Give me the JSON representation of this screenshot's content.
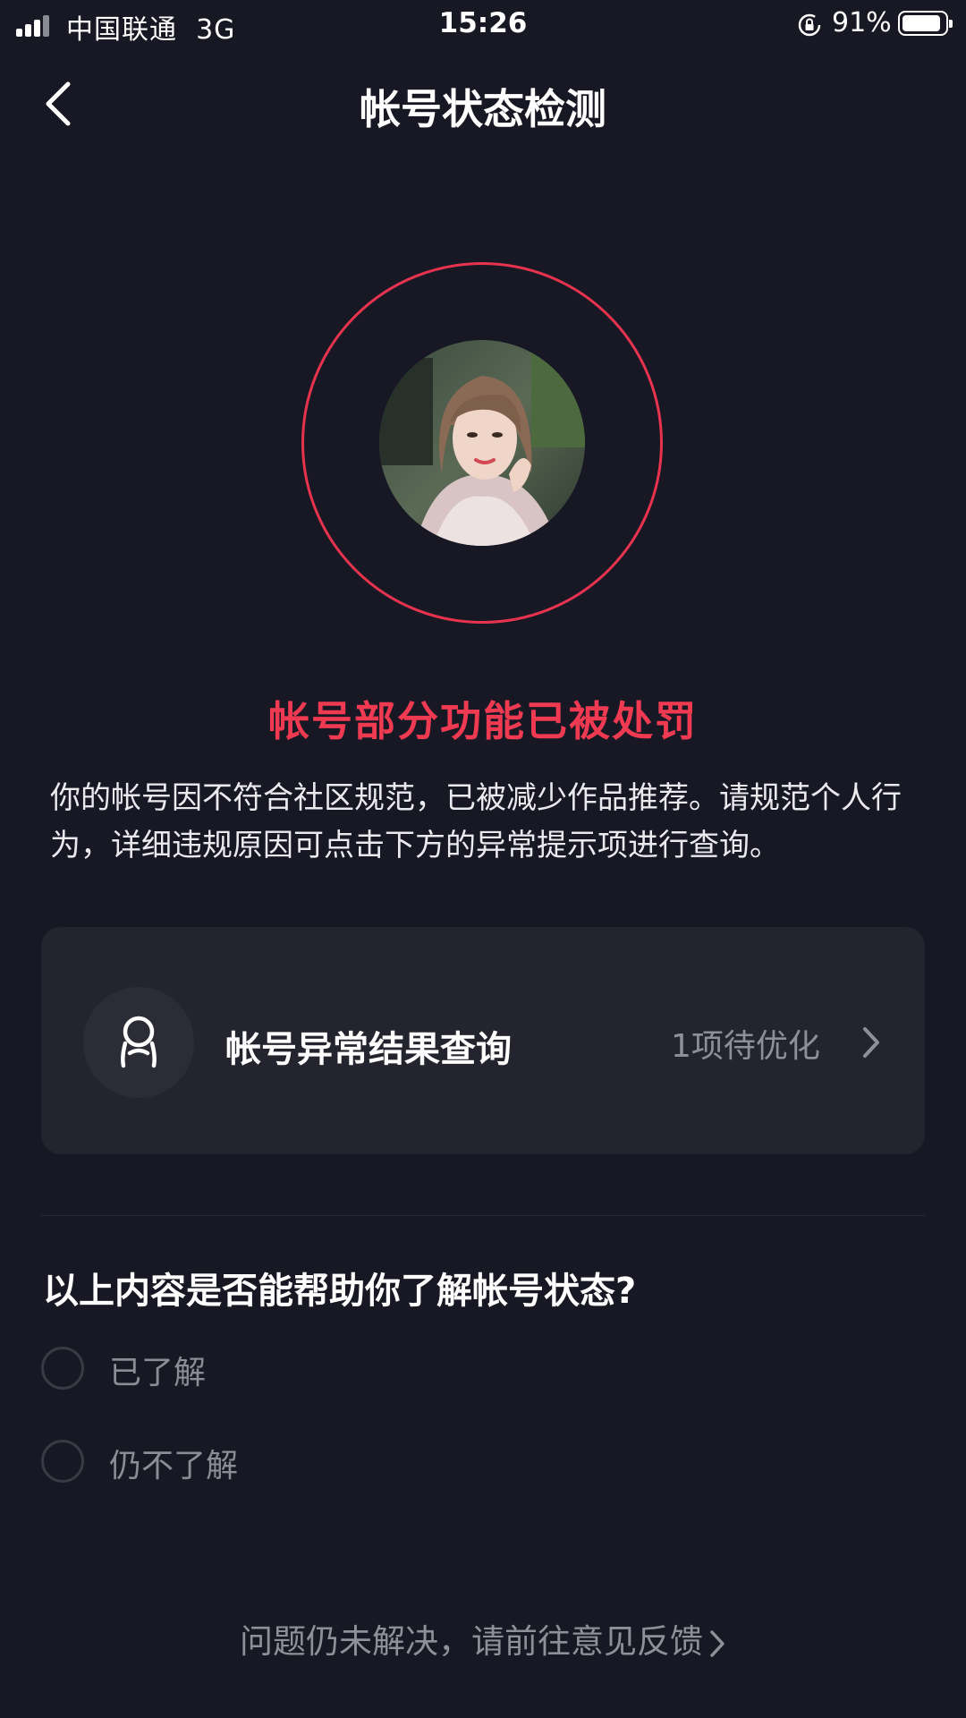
{
  "status_bar": {
    "carrier": "中国联通",
    "network": "3G",
    "time": "15:26",
    "battery_percent": "91%",
    "battery_level": 0.91
  },
  "nav": {
    "title": "帐号状态检测"
  },
  "status": {
    "heading": "帐号部分功能已被处罚",
    "description": "你的帐号因不符合社区规范，已被减少作品推荐。请规范个人行为，详细违规原因可点击下方的异常提示项进行查询。"
  },
  "result_card": {
    "title": "帐号异常结果查询",
    "count_text": "1项待优化"
  },
  "feedback": {
    "question": "以上内容是否能帮助你了解帐号状态?",
    "options": [
      {
        "label": "已了解"
      },
      {
        "label": "仍不了解"
      }
    ]
  },
  "footer": {
    "link_text": "问题仍未解决，请前往意见反馈"
  },
  "colors": {
    "background": "#181824",
    "accent_red": "#f03a52",
    "ring_red": "#e8334f",
    "card_bg": "#24242e",
    "muted_text": "#8f8f98"
  }
}
